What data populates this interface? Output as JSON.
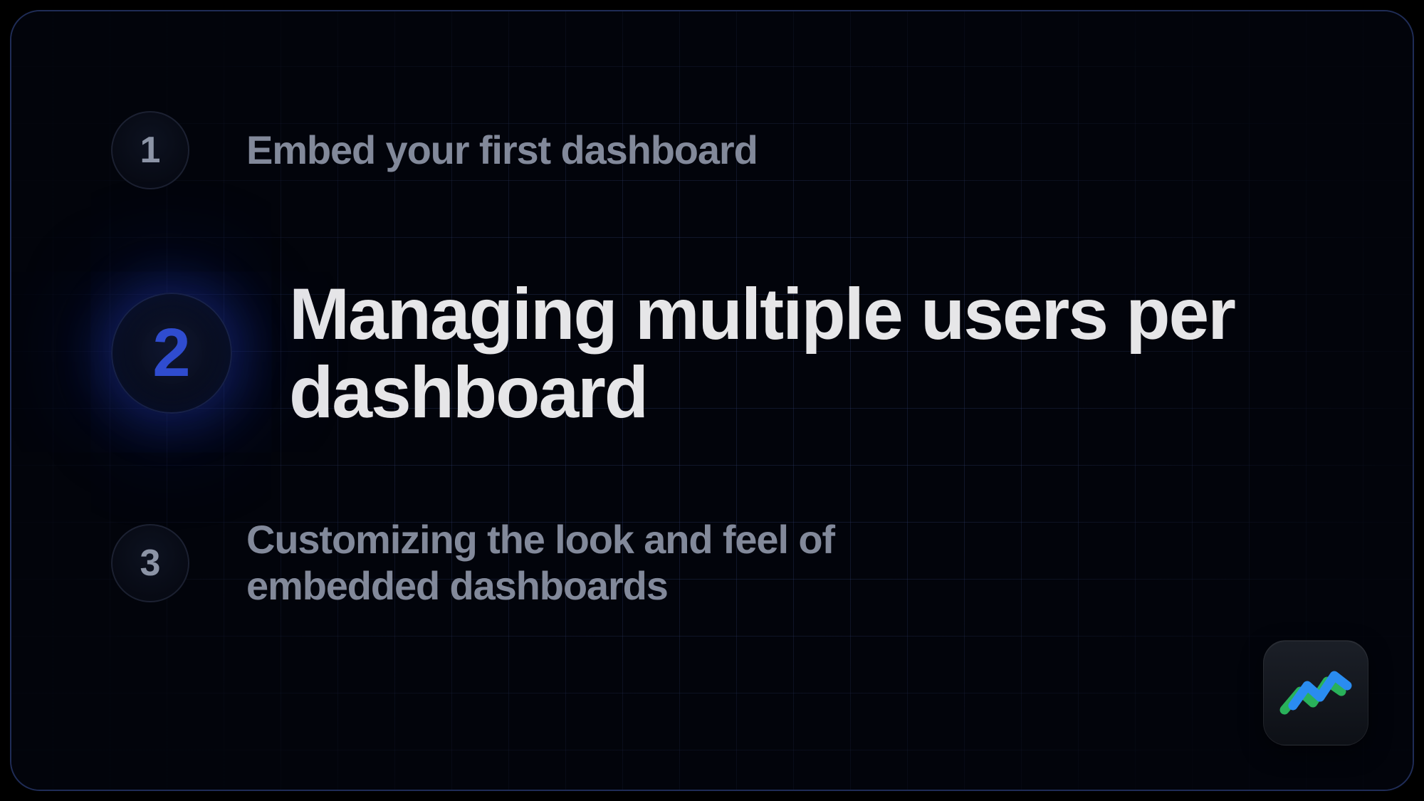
{
  "steps": [
    {
      "number": "1",
      "label": "Embed your first dashboard",
      "active": false
    },
    {
      "number": "2",
      "label": "Managing multiple users per dashboard",
      "active": true
    },
    {
      "number": "3",
      "label": "Customizing the look and feel of embedded dashboards",
      "active": false
    }
  ],
  "colors": {
    "accent": "#2f4ccf",
    "logo_green": "#29b15a",
    "logo_blue": "#2a8cf0"
  }
}
